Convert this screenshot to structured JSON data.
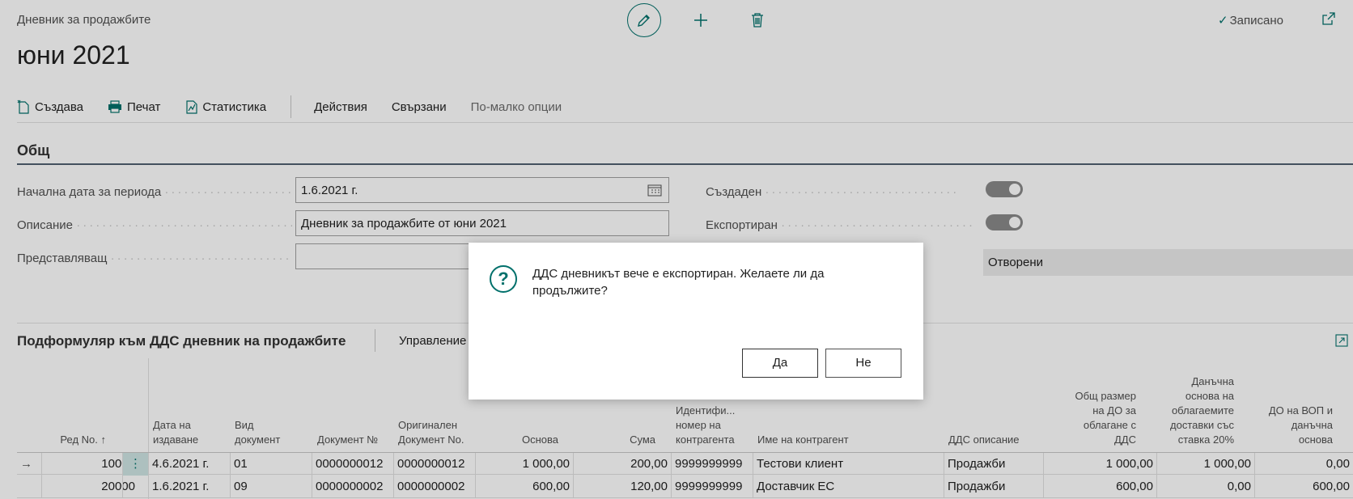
{
  "header": {
    "breadcrumb": "Дневник за продажбите",
    "title": "юни 2021",
    "saved_label": "Записано",
    "actions": {
      "edit_icon": "pencil-icon",
      "add_icon": "plus-icon",
      "delete_icon": "trash-icon"
    }
  },
  "actionbar": {
    "create": "Създава",
    "print": "Печат",
    "statistics": "Статистика",
    "actions": "Действия",
    "related": "Свързани",
    "fewer_options": "По-малко опции"
  },
  "general": {
    "section_title": "Общ",
    "fields": {
      "start_date_label": "Начална дата за периода",
      "start_date_value": "1.6.2021 г.",
      "description_label": "Описание",
      "description_value": "Дневник за продажбите от юни 2021",
      "representative_label": "Представляващ",
      "representative_value": "",
      "created_label": "Създаден",
      "exported_label": "Експортиран",
      "status_value": "Отворени"
    }
  },
  "subform": {
    "title": "Подформуляр към ДДС дневник на продажбите",
    "manage": "Управление",
    "columns": {
      "line_no": "Ред No. ↑",
      "issue_date": "Дата на издаване",
      "doc_type": "Вид документ",
      "doc_no": "Документ №",
      "orig_doc_no": "Оригинален Документ No.",
      "base": "Основа",
      "amount": "Сума",
      "cp_id": "Идентифи... номер на контрагента",
      "cp_name": "Име на контрагент",
      "vat_desc": "ДДС описание",
      "total_base": "Общ размер на ДО за облагане с ДДС",
      "base20": "Данъчна основа на облагаемите доставки със ставка 20%",
      "vop": "ДО на ВОП и данъчна основа"
    },
    "rows": [
      {
        "line_no": "10000",
        "issue_date": "4.6.2021 г.",
        "doc_type": "01",
        "doc_no": "0000000012",
        "orig_doc_no": "0000000012",
        "base": "1 000,00",
        "amount": "200,00",
        "cp_id": "9999999999",
        "cp_name": "Тестови клиент",
        "vat_desc": "Продажби",
        "total_base": "1 000,00",
        "base20": "1 000,00",
        "vop": "0,00"
      },
      {
        "line_no": "20000",
        "issue_date": "1.6.2021 г.",
        "doc_type": "09",
        "doc_no": "0000000002",
        "orig_doc_no": "0000000002",
        "base": "600,00",
        "amount": "120,00",
        "cp_id": "9999999999",
        "cp_name": "Доставчик ЕС",
        "vat_desc": "Продажби",
        "total_base": "600,00",
        "base20": "0,00",
        "vop": "600,00"
      }
    ]
  },
  "dialog": {
    "message": "ДДС дневникът вече е експортиран. Желаете ли да продължите?",
    "yes": "Да",
    "no": "Не",
    "icon": "question-icon"
  }
}
